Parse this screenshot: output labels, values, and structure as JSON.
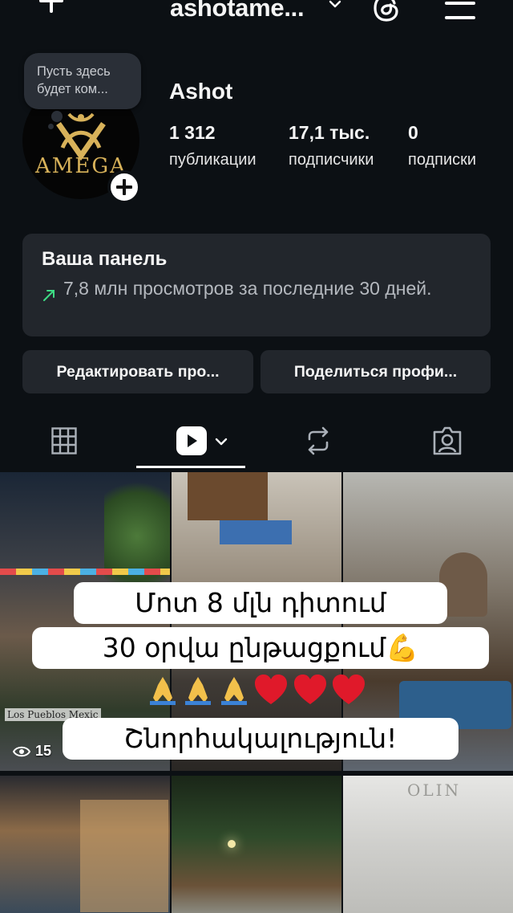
{
  "header": {
    "username": "ashotame...",
    "icons": [
      "plus-icon",
      "chevron-down-icon",
      "threads-icon",
      "menu-icon"
    ]
  },
  "profile": {
    "note": "Пусть здесь будет ком...",
    "avatar_text": "AMEGA",
    "name": "Ashot",
    "stats": [
      {
        "value": "1 312",
        "label": "публикации"
      },
      {
        "value": "17,1 тыс.",
        "label": "подписчики"
      },
      {
        "value": "0",
        "label": "подписки"
      }
    ]
  },
  "dashboard": {
    "title": "Ваша панель",
    "text": "7,8 млн просмотров за последние 30 дней.",
    "trend_color": "#3ddc84"
  },
  "buttons": {
    "edit": "Редактировать про...",
    "share": "Поделиться профи..."
  },
  "tabs": [
    "grid-icon",
    "reels-icon",
    "reposts-icon",
    "tagged-icon"
  ],
  "grid": {
    "views_first": "15",
    "overlay_lines": [
      "Մոտ 8 մլն դիտում",
      "30 օրվա ընթացքում💪",
      "Շնորհակալություն!"
    ],
    "emoji_line": [
      "🙏",
      "🙏",
      "🙏",
      "❤",
      "❤",
      "❤"
    ],
    "watermark": "Los Pueblos Mexic"
  }
}
